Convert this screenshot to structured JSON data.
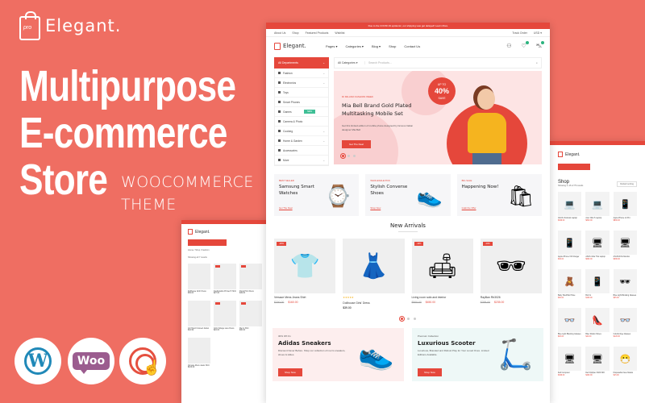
{
  "brand": {
    "name": "Elegant.",
    "logo_tag": "pro"
  },
  "headline": {
    "line1": "Multipurpose",
    "line2": "E-commerce",
    "line3": "Store",
    "sub1": "WOOCOMMERCE",
    "sub2": "THEME"
  },
  "badges": [
    {
      "icon": "wordpress-icon"
    },
    {
      "icon": "woocommerce-icon",
      "label": "Woo"
    },
    {
      "icon": "touch-icon"
    }
  ],
  "colors": {
    "background": "#ef6e62",
    "accent": "#e5473b",
    "new_badge": "#3fbf96"
  },
  "main": {
    "announcement": "Due to the COVID 19 epidemic, our shipping was get delayed! Learn More",
    "util_left": [
      "About Us",
      "Shop",
      "Featured Products",
      "Wishlist"
    ],
    "util_right": [
      "Track Order",
      "USD ▾"
    ],
    "logo": "Elegant.",
    "nav": [
      "Pages ▾",
      "Categories ▾",
      "Blog ▾",
      "Shop",
      "Contact Us"
    ],
    "header_icons": [
      "user-icon",
      "wishlist-icon",
      "cart-icon"
    ],
    "all_departments": "All Departments",
    "search_category": "All Categories ▾",
    "search_placeholder": "Search Products...",
    "departments": [
      {
        "label": "Fashion",
        "chevron": true
      },
      {
        "label": "Electronics",
        "chevron": true
      },
      {
        "label": "Toys"
      },
      {
        "label": "Smart Phones"
      },
      {
        "label": "Games",
        "badge": "NEW"
      },
      {
        "label": "Camera & Photo"
      },
      {
        "label": "Cooking",
        "chevron": true
      },
      {
        "label": "Home & Garden",
        "chevron": true
      },
      {
        "label": "Accessories"
      },
      {
        "label": "More",
        "chevron": true
      }
    ],
    "hero": {
      "kicker": "DI MILANO FASHION WEEK",
      "title": "Mia Bell Brand Gold Plated Multitasking Mobile Set",
      "text": "Get this limited edition of mobile phone designed by famous Italian designer Mia Bell",
      "button": "Get The Deal",
      "save_top": "UP TO",
      "save_value": "40%",
      "save_bottom": "SAVE",
      "slides": 3,
      "active_slide": 1
    },
    "promos": [
      {
        "kicker": "BEST SELLER",
        "title": "Samsung Smart Watches",
        "link": "Get The Deal",
        "icon": "⌚"
      },
      {
        "kicker": "WHOLESALE PICK",
        "title": "Stylish Converse Shoes",
        "link": "Shop Now",
        "icon": "👟"
      },
      {
        "kicker": "BIG SALE",
        "title": "Happening Now!",
        "link": "Grab the Offer",
        "icon": "🛍"
      }
    ],
    "new_arrivals_title": "New Arrivals",
    "products": [
      {
        "name": "Versace Mens Jeans Shirt",
        "old": "$200.00",
        "price": "$160.00",
        "sale": "-20%",
        "icon": "👕"
      },
      {
        "name": "Dollhouse Girls' Dress",
        "price": "$39.00",
        "stars": "★★★★★",
        "icon": "👗"
      },
      {
        "name": "Living room sofa and interior",
        "old": "$500.00",
        "price": "$450.00",
        "sale": "-10%",
        "icon": "🛋"
      },
      {
        "name": "RayBan Rb3026",
        "old": "$299.00",
        "price": "$235.00",
        "sale": "-20%",
        "icon": "🕶"
      }
    ],
    "arrival_pages": 3,
    "banners": [
      {
        "kicker": "30% Off On",
        "title": "Adidas Sneakers",
        "text": "Discount Never Before. Shop our collection of men's sneakers, shoes & slides.",
        "button": "Shop Now",
        "icon": "👟"
      },
      {
        "kicker": "Premium Collection",
        "title": "Luxurious Scooter",
        "text": "Luxurious, Branded and Robust Play for Your Loved Ones. Limited Editions Available.",
        "button": "Shop Now",
        "icon": "🛴"
      }
    ]
  },
  "left_window": {
    "logo": "Elegant.",
    "breadcrumb": "Home / Shop / Fashion",
    "results": "Showing all 7 results",
    "products": [
      {
        "name": "Dollhouse Girls' Dress",
        "price": "$39.00"
      },
      {
        "name": "Fashionable Printed T-Shirt",
        "price": "$27.00"
      },
      {
        "name": "Floral Print Dress",
        "price": "$49.00"
      },
      {
        "name": "Girl Hand Crossed Jacket",
        "price": "$44.99"
      },
      {
        "name": "Girls Vintage Lace Dress",
        "price": "$24.00"
      },
      {
        "name": "Men's Shirt",
        "price": "$30.00"
      },
      {
        "name": "Versace Mens Jeans Shirt",
        "price": "$160.00"
      }
    ]
  },
  "right_window": {
    "logo": "Elegant.",
    "title": "Shop",
    "results": "Showing 1–16 of 75 results",
    "sort": "Default sorting",
    "products": [
      {
        "name": "ASUS Vivobook Laptop",
        "price": "$499.00",
        "icon": "💻"
      },
      {
        "name": "Acer Nitro 5 Laptop",
        "price": "$820.00",
        "icon": "💻"
      },
      {
        "name": "Apple iPhone 12 Pro",
        "price": "$800.00",
        "icon": "📱"
      },
      {
        "name": "Apple iPhone XR Charger",
        "price": "$49.00",
        "icon": "📱"
      },
      {
        "name": "ASUS Ultra Thin Laptop",
        "price": "$690.00",
        "icon": "🖥"
      },
      {
        "name": "ASUS ROG Monitor",
        "price": "$380.00",
        "icon": "🖥"
      },
      {
        "name": "Baby Shell Bell Hose",
        "price": "$30.00",
        "icon": "🧸"
      },
      {
        "name": "BLU G",
        "price": "$190.00",
        "icon": "📱"
      },
      {
        "name": "Blue Light Blocking Glasses",
        "price": "$35.00",
        "icon": "🕶"
      },
      {
        "name": "Blue Light Blocking Glasses",
        "price": "$29.00",
        "icon": "👓"
      },
      {
        "name": "Blue Stiletto Shoes",
        "price": "$44.00",
        "icon": "👠"
      },
      {
        "name": "Colorful Eye Glasses",
        "price": "$120.00",
        "icon": "👓"
      },
      {
        "name": "Dell Computer",
        "price": "$499.00",
        "icon": "🖥"
      },
      {
        "name": "Dell Optiplex 3020 SFF",
        "price": "$290.00",
        "icon": "🖥"
      },
      {
        "name": "Disposable Face Masks",
        "price": "$15.00",
        "icon": "😷"
      }
    ]
  }
}
